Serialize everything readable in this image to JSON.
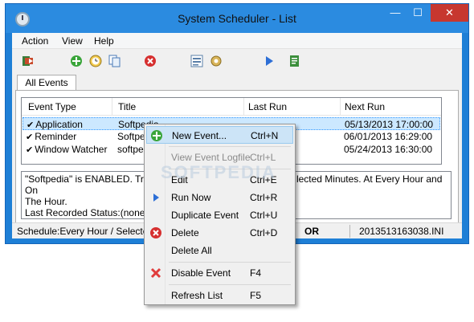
{
  "window": {
    "title": "System Scheduler - List",
    "controls": {
      "minimize": "—",
      "maximize": "☐",
      "close": "✕"
    }
  },
  "menubar": {
    "items": [
      "Action",
      "View",
      "Help"
    ]
  },
  "toolbar": {
    "icons": [
      "exit-icon",
      "add-event-icon",
      "clock-icon",
      "copy-icon",
      "delete-icon",
      "list-icon",
      "settings-icon",
      "run-icon",
      "logfile-icon"
    ]
  },
  "tabs": [
    "All Events"
  ],
  "list": {
    "columns": [
      "Event Type",
      "Title",
      "Last Run",
      "Next Run"
    ],
    "rows": [
      {
        "type": "Application",
        "title": "Softpedia",
        "last_run": "",
        "next_run": "05/13/2013 17:00:00",
        "check": "✔"
      },
      {
        "type": "Reminder",
        "title": "Softpedi",
        "last_run": "",
        "next_run": "06/01/2013 16:29:00",
        "check": "✔"
      },
      {
        "type": "Window Watcher",
        "title": "softped",
        "last_run": "",
        "next_run": "05/24/2013 16:30:00",
        "check": "✔"
      }
    ]
  },
  "description": {
    "line1_a": "\"Softpedia\" is ENABLED. Trigg",
    "line1_b": "lected Minutes. At Every Hour and On",
    "line2": "The Hour.",
    "line3": "Last Recorded Status:(none)."
  },
  "statusbar": {
    "schedule": "Schedule:Every Hour / Selecte",
    "mode": "OR",
    "file": "2013513163038.INI"
  },
  "context_menu": {
    "items": [
      {
        "label": "New Event...",
        "shortcut": "Ctrl+N",
        "icon": "add-icon",
        "highlighted": true
      },
      {
        "label": "View Event Logfile",
        "shortcut": "Ctrl+L",
        "disabled": true
      },
      {
        "label": "Edit",
        "shortcut": "Ctrl+E"
      },
      {
        "label": "Run Now",
        "shortcut": "Ctrl+R",
        "icon": "play-icon"
      },
      {
        "label": "Duplicate Event",
        "shortcut": "Ctrl+U"
      },
      {
        "label": "Delete",
        "shortcut": "Ctrl+D",
        "icon": "delete-icon"
      },
      {
        "label": "Delete All",
        "shortcut": ""
      },
      {
        "label": "Disable Event",
        "shortcut": "F4",
        "icon": "disable-icon"
      },
      {
        "label": "Refresh List",
        "shortcut": "F5"
      }
    ]
  },
  "watermark": "SOFTPEDIA",
  "colors": {
    "titlebar": "#2b8be0",
    "close": "#c7372f",
    "selection": "#cce8ff",
    "highlight": "#cce4f7"
  }
}
